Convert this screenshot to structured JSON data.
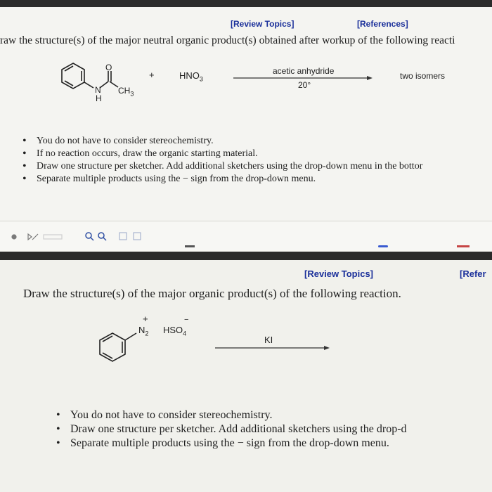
{
  "panel1": {
    "review_topics": "[Review Topics]",
    "references": "[References]",
    "question": "raw the structure(s) of the major neutral organic product(s) obtained after workup of the following reacti",
    "reaction": {
      "o_label": "O",
      "n_label": "N",
      "h_label": "H",
      "ch3_label": "CH",
      "ch3_sub": "3",
      "plus": "+",
      "reagent": "HNO",
      "reagent_sub": "3",
      "above_arrow": "acetic anhydride",
      "below_arrow": "20°",
      "product": "two isomers"
    },
    "bullets": [
      "You do not have to consider stereochemistry.",
      "If no reaction occurs, draw the organic starting material.",
      "Draw one structure per sketcher. Add additional sketchers using the drop-down menu in the bottor",
      "Separate multiple products using the − sign from the drop-down menu."
    ]
  },
  "panel2": {
    "review_topics": "[Review Topics]",
    "references": "[Refer",
    "question": "Draw the structure(s) of the major organic product(s) of the following reaction.",
    "reaction": {
      "plus_charge": "+",
      "minus_charge": "−",
      "diazonium": "N",
      "diazonium_sub": "2",
      "counterion": "HSO",
      "counterion_sub": "4",
      "reagent": "KI"
    },
    "bullets": [
      "You do not have to consider stereochemistry.",
      "Draw one structure per sketcher. Add additional sketchers using the drop-d",
      "Separate multiple products using the − sign from the drop-down menu."
    ]
  },
  "colors": {
    "link": "#1a2f9a",
    "panel_bg": "#f4f4f1",
    "dark_band": "#2a2a2a"
  }
}
